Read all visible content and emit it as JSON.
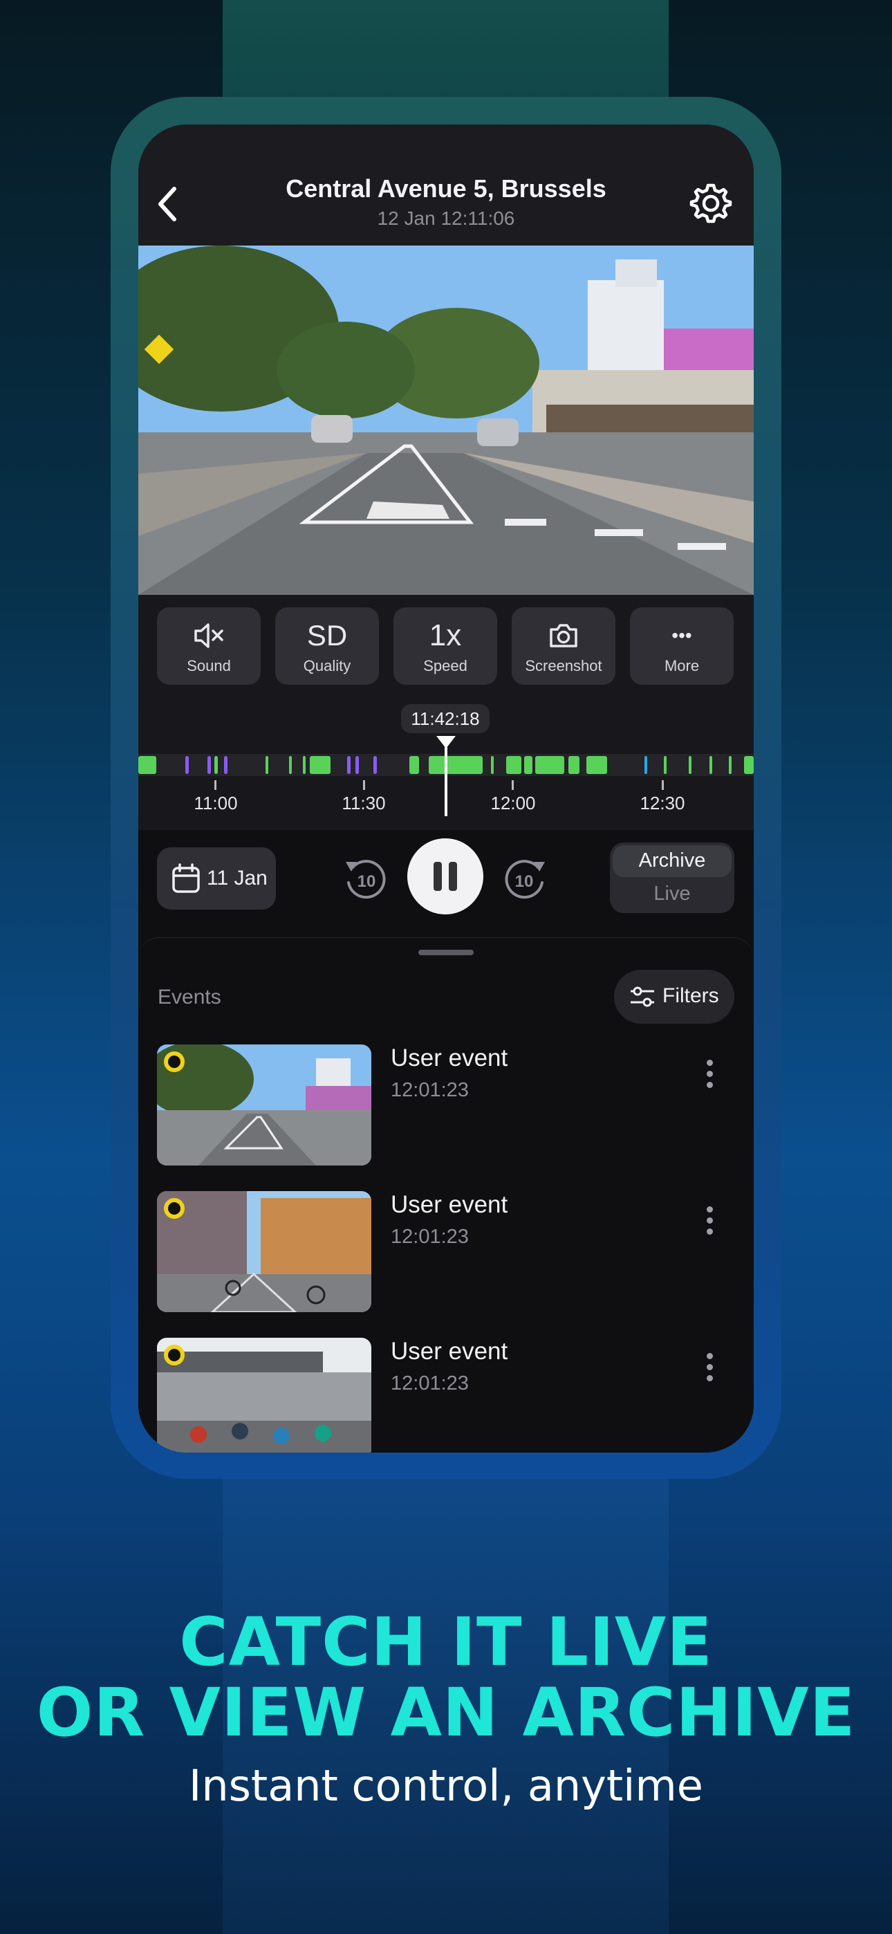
{
  "header": {
    "title": "Central Avenue 5, Brussels",
    "timestamp": "12 Jan 12:11:06",
    "back_icon": "chevron-left-icon",
    "settings_icon": "gear-icon"
  },
  "controls": [
    {
      "icon": "sound-off-icon",
      "label": "Sound"
    },
    {
      "icon": "quality-text",
      "glyph": "SD",
      "label": "Quality"
    },
    {
      "icon": "speed-text",
      "glyph": "1x",
      "label": "Speed"
    },
    {
      "icon": "camera-icon",
      "label": "Screenshot"
    },
    {
      "icon": "more-icon",
      "glyph": "•••",
      "label": "More"
    }
  ],
  "timeline": {
    "current_time": "11:42:18",
    "tick_labels": [
      "11:00",
      "11:30",
      "12:00",
      "12:30"
    ]
  },
  "playback": {
    "date_label": "11 Jan",
    "rewind_label": "10",
    "forward_label": "10",
    "mode_selected": "Archive",
    "mode_other": "Live"
  },
  "events": {
    "title": "Events",
    "filters_label": "Filters",
    "items": [
      {
        "title": "User event",
        "time": "12:01:23"
      },
      {
        "title": "User event",
        "time": "12:01:23"
      },
      {
        "title": "User event",
        "time": "12:01:23"
      }
    ]
  },
  "promo": {
    "line1": "CATCH IT LIVE",
    "line2": "OR VIEW AN ARCHIVE",
    "tagline": "Instant control, anytime"
  },
  "colors": {
    "accent": "#1fe6d6",
    "event_green": "#5ad25a",
    "event_purple": "#8a5cf0",
    "event_blue": "#2aa8e8",
    "event_ring": "#f0d21a"
  }
}
